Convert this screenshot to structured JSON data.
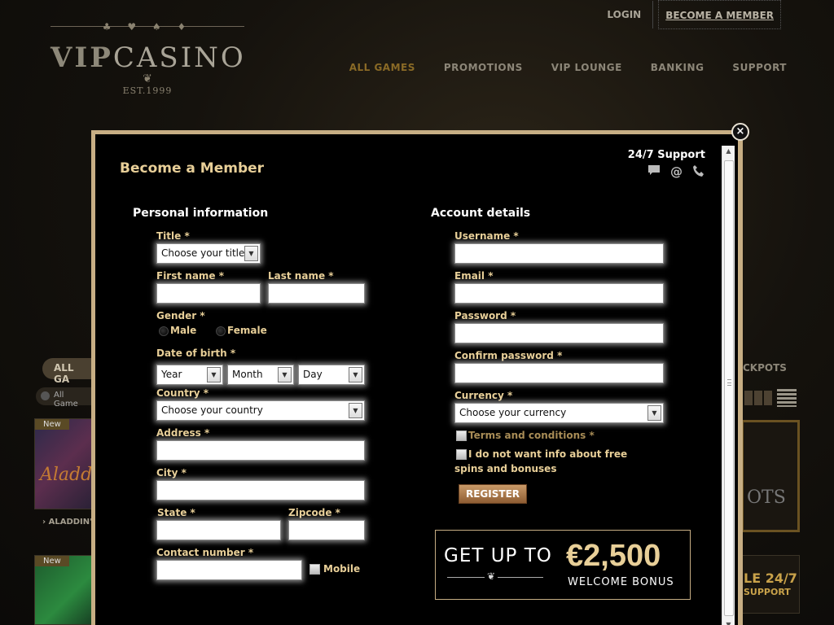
{
  "site": {
    "logo": {
      "suits": "♣ ♥ ♠ ♦",
      "vip": "VIP",
      "casino": "CASINO",
      "est": "EST.1999",
      "flourish": "❦"
    },
    "top_links": {
      "login": "LOGIN",
      "become_member": "BECOME A MEMBER"
    },
    "main_nav": [
      "ALL GAMES",
      "PROMOTIONS",
      "VIP LOUNGE",
      "BANKING",
      "SUPPORT"
    ],
    "active_nav": "ALL GAMES",
    "bg": {
      "left_tab": "ALL GA",
      "left_radio": "All Game",
      "new_badge": "New",
      "aladdin_art": "Aladd",
      "aladdin_label": "› ALADDIN'",
      "right_jackpots": "CKPOTS",
      "right_slots": "OTS",
      "right_247": "LE 24/7",
      "right_support": "SUPPORT"
    }
  },
  "modal": {
    "close": "×",
    "title": "Become a Member",
    "support": {
      "label": "24/7 Support",
      "icons": [
        "chat-icon",
        "email-icon",
        "phone-icon"
      ]
    },
    "personal": {
      "heading": "Personal information",
      "title_label": "Title *",
      "title_value": "Choose your title",
      "first_name_label": "First name *",
      "last_name_label": "Last name *",
      "gender_label": "Gender *",
      "gender_options": [
        "Male",
        "Female"
      ],
      "dob_label": "Date of birth *",
      "dob_year": "Year",
      "dob_month": "Month",
      "dob_day": "Day",
      "country_label": "Country *",
      "country_value": "Choose your country",
      "address_label": "Address *",
      "city_label": "City *",
      "state_label": "State *",
      "zipcode_label": "Zipcode *",
      "contact_label": "Contact number *",
      "mobile_label": "Mobile"
    },
    "account": {
      "heading": "Account details",
      "username_label": "Username *",
      "email_label": "Email *",
      "password_label": "Password *",
      "confirm_label": "Confirm password *",
      "currency_label": "Currency *",
      "currency_value": "Choose your currency",
      "terms_label": "Terms and conditions *",
      "no_info_label": "I do not want info about free spins and bonuses",
      "register_label": "REGISTER"
    },
    "promo": {
      "get_up_to": "GET UP TO",
      "amount": "€2,500",
      "welcome": "WELCOME BONUS",
      "ornament": "❦"
    }
  },
  "colors": {
    "accent_gold": "#e8cf98",
    "modal_border": "#c7ae84",
    "active_nav": "#8a6a26"
  }
}
